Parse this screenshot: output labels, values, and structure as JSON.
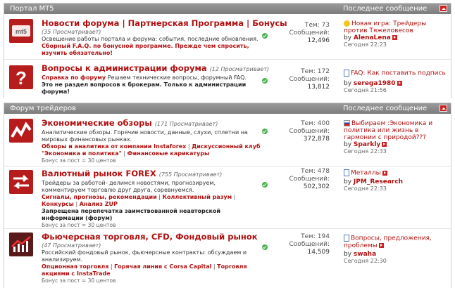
{
  "sections": [
    {
      "title": "Портал МТ5",
      "last_post_header": "Последнее сообщение",
      "forums": [
        {
          "icon": "mt5-logo-icon",
          "title": "Новости форума | Партнерская Программа | Бонусы",
          "viewers": "(35 Просматривает)",
          "desc": "Освещение работы портала и форума: события, последние обновления.",
          "note": "Сборный F.A.Q. по бонусной программе. Прежде чем спросить, изучить обязательно!",
          "topics": "Тем: 73",
          "posts_label": "Сообщений:",
          "posts": "12,496",
          "last_icon": "smile-icon",
          "last_title": "Новая игра: Трейдеры против Тяжеловесов",
          "last_by": "by",
          "last_user": "AlenaLena",
          "last_time": "Сегодня 22:23"
        },
        {
          "icon": "question-mark-icon",
          "title": "Вопросы к администрации форума",
          "viewers": "(12 Просматривает)",
          "sub_prefix": "Справка по форуму",
          "desc": "Решаем технические вопросы, форумный FAQ.",
          "note": "Это не раздел вопросов к брокерам. Только к администрации форума!",
          "topics": "Тем: 172",
          "posts_label": "Сообщений:",
          "posts": "13,812",
          "last_icon": "document-icon",
          "last_title": "FAQ: Как поставить подпись",
          "last_by": "by",
          "last_user": "serega1980",
          "last_time": "Сегодня 21:56"
        }
      ]
    },
    {
      "title": "Форум трейдеров",
      "last_post_header": "Последнее сообщение",
      "forums": [
        {
          "icon": "chart-zigzag-icon",
          "title": "Экономические обзоры",
          "viewers": "(171 Просматривает)",
          "desc": "Аналитические обзоры. Горячие новости, данные, слухи, сплетни на мировых финансовых рынках.",
          "subforums": [
            "Обзоры и аналитика от компании Instaforex",
            "Дискуссионный клуб \"Экономика и политика\"",
            "Финансовые карикатуры"
          ],
          "topics": "Тем: 400",
          "posts_label": "Сообщений:",
          "posts": "372,878",
          "last_icon": "flag-icon",
          "last_title": "Выбираем :Экономика и политика или жизнь в гармонии с природой???",
          "last_by": "by",
          "last_user": "Sparkly",
          "last_time": "Сегодня 22:33"
        },
        {
          "icon": "exchange-arrows-icon",
          "title": "Валютный рынок FOREX",
          "viewers": "(755 Просматривает)",
          "desc": "Трейдеры за работой- делимся новостями, прогнозируем, комментируем торговлю друг друга, соревнуемся.",
          "subforums": [
            "Сигналы, прогнозы, рекомендации",
            "Коллективный разум",
            "Конкурсы",
            "Анализ ZUP"
          ],
          "block_note": "Запрещена перепечатка заимствованной неавторской информации (форум)",
          "bonus": "Бонус за пост = 30 центов",
          "topics": "Тем: 478",
          "posts_label": "Сообщений:",
          "posts": "502,302",
          "last_icon": "document-icon",
          "last_title": "Металлы",
          "last_by": "by",
          "last_user": "JPM_Research",
          "last_time": "Сегодня 22:33"
        },
        {
          "icon": "trend-chart-icon",
          "title": "Фьючерсная торговля, CFD, Фондовый рынок",
          "viewers": "(47 Просматривает)",
          "desc": "Российский фондовый рынок, фьючерсные контракты: обсуждаем и анализируем.",
          "subforums": [
            "Опционная торговля",
            "Горячая линия с Corsa Capital",
            "Торговля акциями с InstaTrade"
          ],
          "bonus": "Бонус за пост = 30 центов",
          "topics": "Тем: 194",
          "posts_label": "Сообщений:",
          "posts": "14,509",
          "last_icon": "document-icon",
          "last_title": "Вопросы, предложения, проблемы",
          "last_by": "by",
          "last_user": "swaha",
          "last_time": "Сегодня 22:30"
        }
      ],
      "bonus_row1": "Бонус за пост = 30 центов"
    }
  ],
  "colors": {
    "accent": "#b01010",
    "header_bg": "#8a8a8a",
    "check": "#4caf50"
  }
}
